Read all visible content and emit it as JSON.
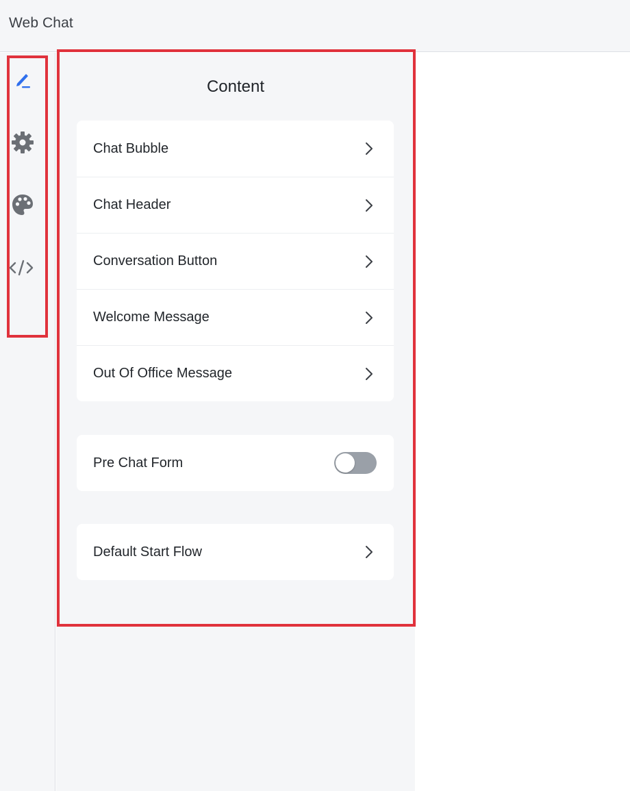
{
  "header": {
    "title": "Web Chat"
  },
  "rail": {
    "icons": [
      {
        "name": "pencil-icon",
        "color": "#2f6fed"
      },
      {
        "name": "gear-icon",
        "color": "#6b6f75"
      },
      {
        "name": "palette-icon",
        "color": "#6b6f75"
      },
      {
        "name": "code-icon",
        "color": "#6b6f75"
      }
    ]
  },
  "panel": {
    "title": "Content",
    "items": [
      {
        "label": "Chat Bubble"
      },
      {
        "label": "Chat Header"
      },
      {
        "label": "Conversation Button"
      },
      {
        "label": "Welcome Message"
      },
      {
        "label": "Out Of Office Message"
      }
    ],
    "pre_chat": {
      "label": "Pre Chat Form",
      "enabled": false
    },
    "start_flow": {
      "label": "Default Start Flow"
    }
  },
  "colors": {
    "highlight": "#e0323c",
    "toggle_off": "#9aa0a8",
    "accent": "#2f6fed"
  }
}
